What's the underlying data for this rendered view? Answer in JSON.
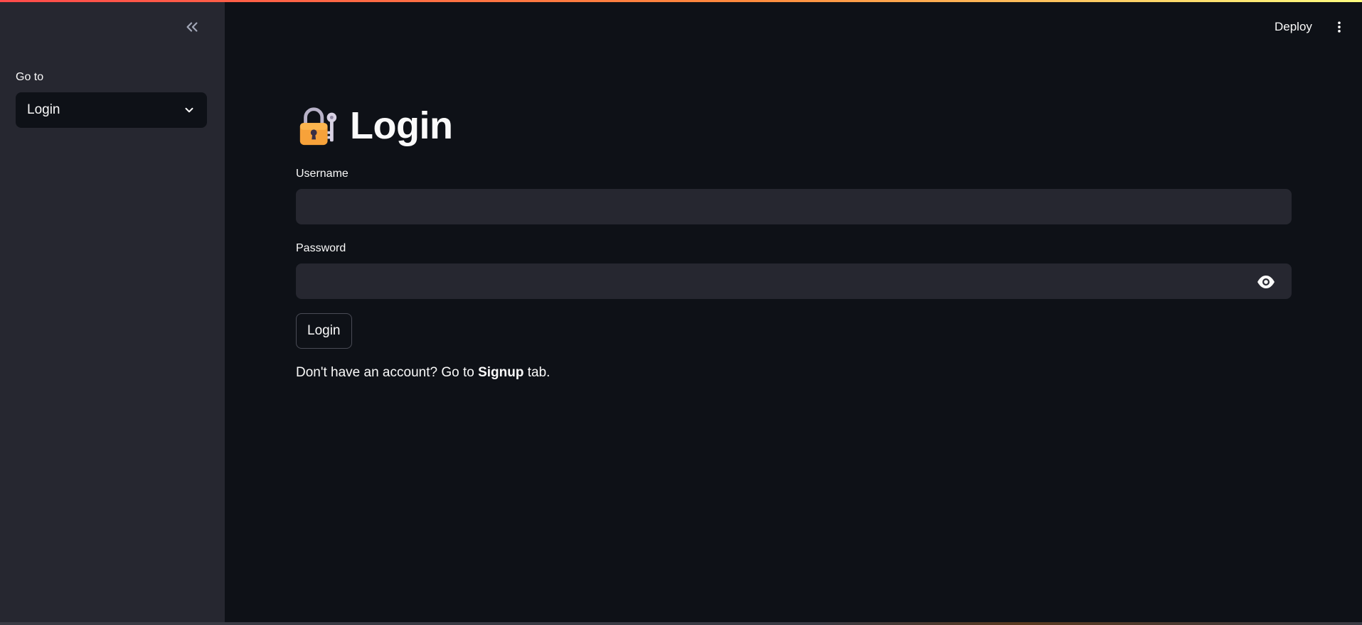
{
  "sidebar": {
    "collapse_icon": "double-chevron-left-icon",
    "nav_label": "Go to",
    "nav_select": {
      "value": "Login",
      "chevron_icon": "chevron-down-icon"
    }
  },
  "toolbar": {
    "deploy_label": "Deploy",
    "menu_icon": "vertical-ellipsis-icon"
  },
  "main": {
    "title_icon": "locked-with-key-emoji",
    "title": "Login",
    "username": {
      "label": "Username",
      "value": "",
      "placeholder": ""
    },
    "password": {
      "label": "Password",
      "value": "",
      "placeholder": "",
      "toggle_icon": "eye-icon"
    },
    "submit_label": "Login",
    "hint": {
      "prefix": "Don't have an account? Go to ",
      "link_text": "Signup",
      "suffix": " tab."
    }
  },
  "colors": {
    "sidebar_bg": "#262730",
    "main_bg": "#0e1117",
    "input_bg": "#262730",
    "text": "#fafafa",
    "accent_gradient_start": "#ff4b4b",
    "accent_gradient_end": "#fffd80"
  }
}
